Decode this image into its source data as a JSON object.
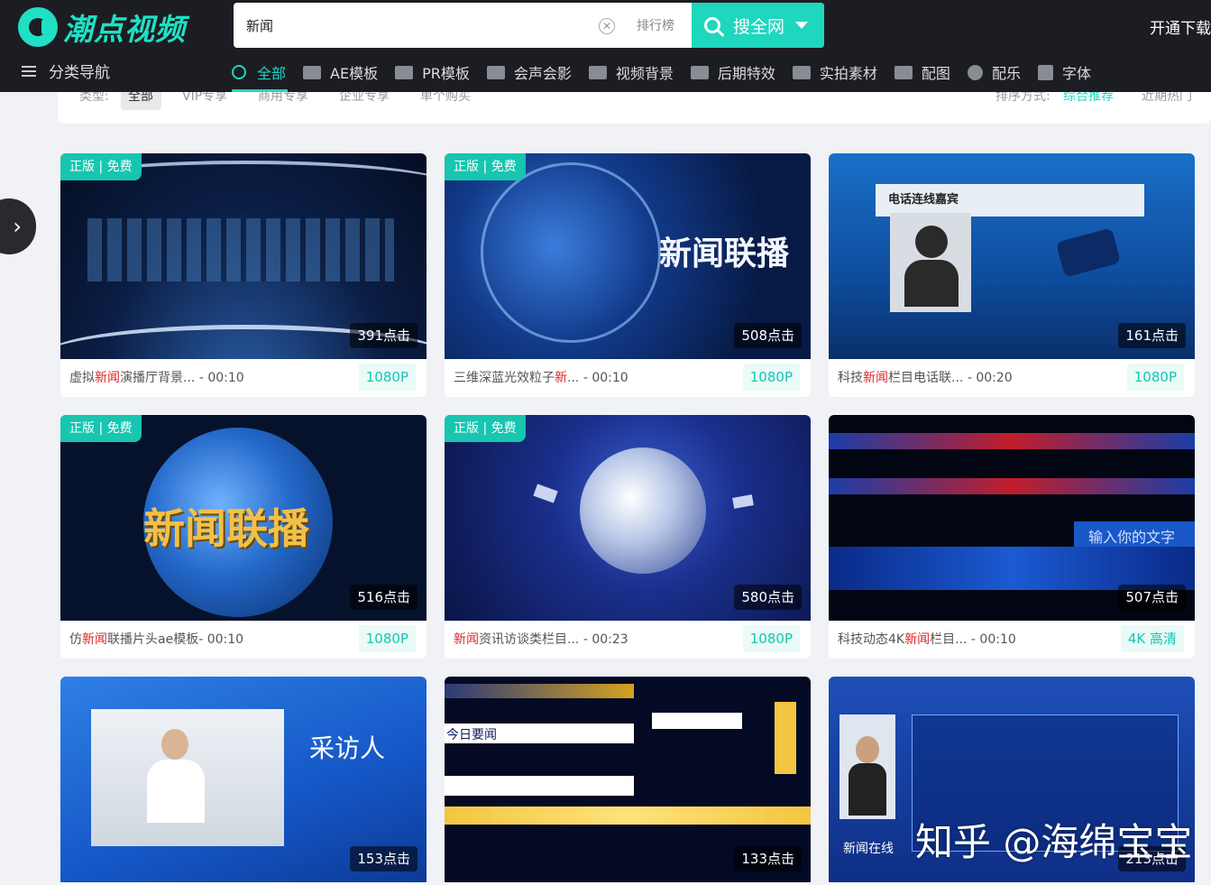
{
  "header": {
    "logo_text": "潮点视频",
    "search": {
      "value": "新闻",
      "rank_label": "排行榜",
      "button_label": "搜全网"
    },
    "vip_label": "开通下载",
    "nav_label": "分类导航",
    "categories": [
      {
        "label": "全部",
        "icon": "search-icon"
      },
      {
        "label": "AE模板",
        "icon": "ae-icon"
      },
      {
        "label": "PR模板",
        "icon": "pr-icon"
      },
      {
        "label": "会声会影",
        "icon": "video-icon"
      },
      {
        "label": "视频背景",
        "icon": "background-icon"
      },
      {
        "label": "后期特效",
        "icon": "effects-icon"
      },
      {
        "label": "实拍素材",
        "icon": "camera-icon"
      },
      {
        "label": "配图",
        "icon": "image-icon"
      },
      {
        "label": "配乐",
        "icon": "music-icon"
      },
      {
        "label": "字体",
        "icon": "font-icon"
      }
    ]
  },
  "filter": {
    "type_label": "类型:",
    "types": [
      "全部",
      "VIP专享",
      "商用专享",
      "企业专享",
      "单个购买"
    ],
    "sort_label": "排序方式:",
    "sort_active": "综合推荐",
    "sort_other": "近期热门"
  },
  "cards": [
    {
      "badge": "正版 | 免费",
      "clicks": "391点击",
      "pre": "虚拟",
      "hl": "新闻",
      "post": "演播厅背景...",
      "duration": "- 00:10",
      "res": "1080P",
      "art": ""
    },
    {
      "badge": "正版 | 免费",
      "clicks": "508点击",
      "pre": "三维深蓝光效粒子",
      "hl": "新",
      "post": "...",
      "duration": "- 00:10",
      "res": "1080P",
      "art": "新闻联播"
    },
    {
      "badge": "",
      "clicks": "161点击",
      "pre": "科技",
      "hl": "新闻",
      "post": "栏目电话联...",
      "duration": "- 00:20",
      "res": "1080P",
      "art": "电话连线嘉宾"
    },
    {
      "badge": "正版 | 免费",
      "clicks": "516点击",
      "pre": "仿",
      "hl": "新闻",
      "post": "联播片头ae模板",
      "duration": "- 00:10",
      "res": "1080P",
      "art": "新闻联播"
    },
    {
      "badge": "正版 | 免费",
      "clicks": "580点击",
      "pre": "",
      "hl": "新闻",
      "post": "资讯访谈类栏目...",
      "duration": "- 00:23",
      "res": "1080P",
      "art": ""
    },
    {
      "badge": "",
      "clicks": "507点击",
      "pre": "科技动态4K",
      "hl": "新闻",
      "post": "栏目...",
      "duration": "- 00:10",
      "res": "4K 高清",
      "art": "输入你的文字"
    },
    {
      "badge": "",
      "clicks": "153点击",
      "pre": "",
      "hl": "",
      "post": "",
      "duration": "",
      "res": "",
      "art": "采访人"
    },
    {
      "badge": "",
      "clicks": "133点击",
      "pre": "",
      "hl": "",
      "post": "",
      "duration": "",
      "res": "",
      "art": "今日要闻"
    },
    {
      "badge": "",
      "clicks": "213点击",
      "pre": "",
      "hl": "",
      "post": "",
      "duration": "",
      "res": "",
      "art": "新闻在线"
    }
  ],
  "watermark": "知乎 @海绵宝宝",
  "colors": {
    "accent": "#1fd6bf",
    "header_bg": "#1c1d22",
    "highlight": "#e02525"
  }
}
